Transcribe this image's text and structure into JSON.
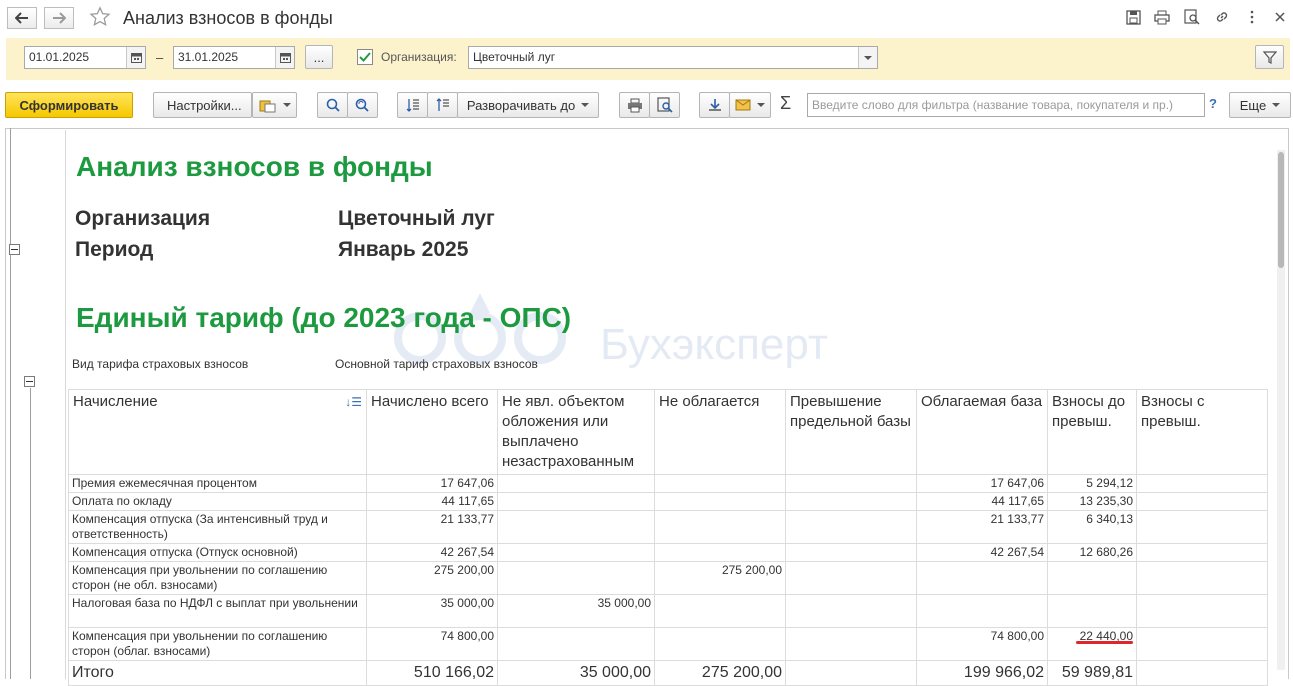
{
  "window": {
    "title": "Анализ взносов в фонды"
  },
  "params": {
    "date_from": "01.01.2025",
    "date_separator": "–",
    "date_to": "31.01.2025",
    "period_button": "...",
    "org_checked": true,
    "org_label": "Организация:",
    "org_value": "Цветочный луг"
  },
  "commandbar": {
    "generate": "Сформировать",
    "settings": "Настройки...",
    "expand_to": "Разворачивать до",
    "filter_placeholder": "Введите слово для фильтра (название товара, покупателя и пр.)",
    "help": "?",
    "more": "Еще",
    "sum_symbol": "Σ"
  },
  "report": {
    "title": "Анализ взносов в фонды",
    "org_label": "Организация",
    "org_value": "Цветочный луг",
    "period_label": "Период",
    "period_value": "Январь 2025",
    "section_title": "Единый тариф (до 2023 года - ОПС)",
    "tariff_kind_label": "Вид тарифа страховых взносов",
    "tariff_kind_value": "Основной тариф страховых взносов",
    "watermark": "Бухэксперт",
    "columns": [
      "Начисление",
      "Начислено всего",
      "Не явл. объектом обложения или выплачено незастрахованным",
      "Не облагается",
      "Превышение предельной базы",
      "Облагаемая база",
      "Взносы до превыш.",
      "Взносы с превыш."
    ],
    "rows": [
      [
        "Премия ежемесячная процентом",
        "17 647,06",
        "",
        "",
        "",
        "17 647,06",
        "5 294,12",
        ""
      ],
      [
        "Оплата по окладу",
        "44 117,65",
        "",
        "",
        "",
        "44 117,65",
        "13 235,30",
        ""
      ],
      [
        "Компенсация отпуска (За интенсивный труд и ответственность)",
        "21 133,77",
        "",
        "",
        "",
        "21 133,77",
        "6 340,13",
        ""
      ],
      [
        "Компенсация отпуска (Отпуск основной)",
        "42 267,54",
        "",
        "",
        "",
        "42 267,54",
        "12 680,26",
        ""
      ],
      [
        "Компенсация при увольнении по соглашению сторон (не обл. взносами)",
        "275 200,00",
        "",
        "275 200,00",
        "",
        "",
        "",
        ""
      ],
      [
        "Налоговая база по НДФЛ с выплат при увольнении",
        "35 000,00",
        "35 000,00",
        "",
        "",
        "",
        "",
        ""
      ],
      [
        "Компенсация при увольнении по соглашению сторон (облаг. взносами)",
        "74 800,00",
        "",
        "",
        "",
        "74 800,00",
        "22 440,00",
        ""
      ]
    ],
    "total": [
      "Итого",
      "510 166,02",
      "35 000,00",
      "275 200,00",
      "",
      "199 966,02",
      "59 989,81",
      ""
    ]
  }
}
